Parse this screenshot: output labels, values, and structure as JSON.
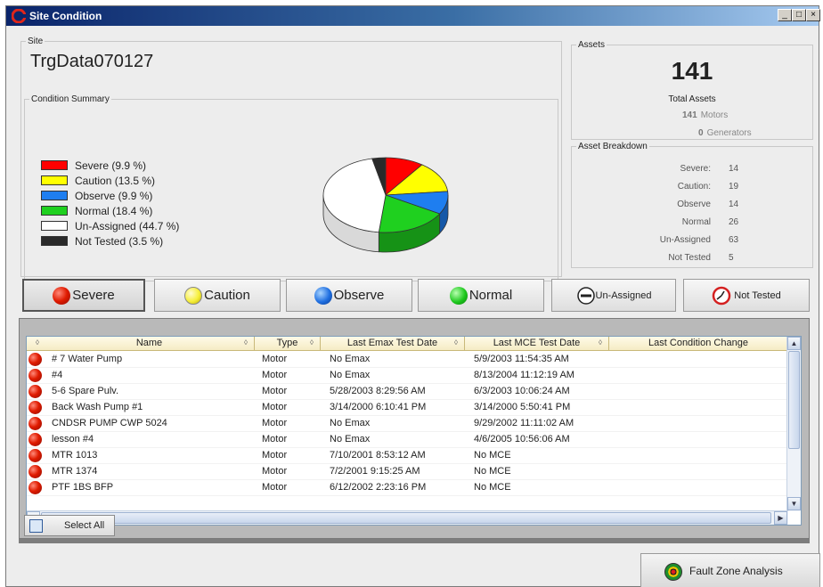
{
  "window": {
    "title": "Site Condition",
    "controls": {
      "minimize": "_",
      "restore": "□",
      "close": "×"
    }
  },
  "site": {
    "legend": "Site",
    "name": "TrgData070127"
  },
  "condition_summary": {
    "legend": "Condition Summary",
    "items": [
      {
        "label": "Severe (9.9 %)",
        "color": "#ff0000"
      },
      {
        "label": "Caution (13.5 %)",
        "color": "#ffff00"
      },
      {
        "label": "Observe (9.9 %)",
        "color": "#1e7ef0"
      },
      {
        "label": "Normal (18.4 %)",
        "color": "#1fd01f"
      },
      {
        "label": "Un-Assigned (44.7 %)",
        "color": "#ffffff"
      },
      {
        "label": "Not Tested (3.5 %)",
        "color": "#2a2a2a"
      }
    ]
  },
  "chart_data": {
    "type": "pie",
    "categories": [
      "Severe",
      "Caution",
      "Observe",
      "Normal",
      "Un-Assigned",
      "Not Tested"
    ],
    "values": [
      9.9,
      13.5,
      9.9,
      18.4,
      44.7,
      3.5
    ],
    "colors": [
      "#ff0000",
      "#ffff00",
      "#1e7ef0",
      "#1fd01f",
      "#ffffff",
      "#2a2a2a"
    ],
    "style": "3d",
    "title": ""
  },
  "assets": {
    "legend": "Assets",
    "total": "141",
    "total_label": "Total Assets",
    "motors_count": "141",
    "motors_label": "Motors",
    "generators_count": "0",
    "generators_label": "Generators"
  },
  "breakdown": {
    "legend": "Asset Breakdown",
    "rows": [
      {
        "label": "Severe:",
        "value": "14"
      },
      {
        "label": "Caution:",
        "value": "19"
      },
      {
        "label": "Observe",
        "value": "14"
      },
      {
        "label": "Normal",
        "value": "26"
      },
      {
        "label": "Un-Assigned",
        "value": "63"
      },
      {
        "label": "Not Tested",
        "value": "5"
      }
    ]
  },
  "filters": {
    "severe": "Severe",
    "caution": "Caution",
    "observe": "Observe",
    "normal": "Normal",
    "unassigned": "Un-Assigned",
    "not_tested": "Not Tested"
  },
  "table": {
    "columns": [
      "Name",
      "Type",
      "Last Emax Test Date",
      "Last MCE Test Date",
      "Last Condition Change"
    ],
    "rows": [
      [
        "# 7 Water Pump",
        "Motor",
        "No Emax",
        "5/9/2003 11:54:35 AM"
      ],
      [
        "#4",
        "Motor",
        "No Emax",
        "8/13/2004 11:12:19 AM"
      ],
      [
        "5-6 Spare Pulv.",
        "Motor",
        "5/28/2003 8:29:56 AM",
        "6/3/2003 10:06:24 AM"
      ],
      [
        "Back Wash Pump #1",
        "Motor",
        "3/14/2000 6:10:41 PM",
        "3/14/2000 5:50:41 PM"
      ],
      [
        "CNDSR PUMP CWP 5024",
        "Motor",
        "No Emax",
        "9/29/2002 11:11:02 AM"
      ],
      [
        "lesson #4",
        "Motor",
        "No Emax",
        "4/6/2005 10:56:06 AM"
      ],
      [
        "MTR 1013",
        "Motor",
        "7/10/2001 8:53:12 AM",
        "No MCE"
      ],
      [
        "MTR 1374",
        "Motor",
        "7/2/2001 9:15:25 AM",
        "No MCE"
      ],
      [
        "PTF 1BS BFP",
        "Motor",
        "6/12/2002 2:23:16 PM",
        "No MCE"
      ]
    ]
  },
  "select_all": "Select All",
  "fault_zone": "Fault Zone Analysis"
}
